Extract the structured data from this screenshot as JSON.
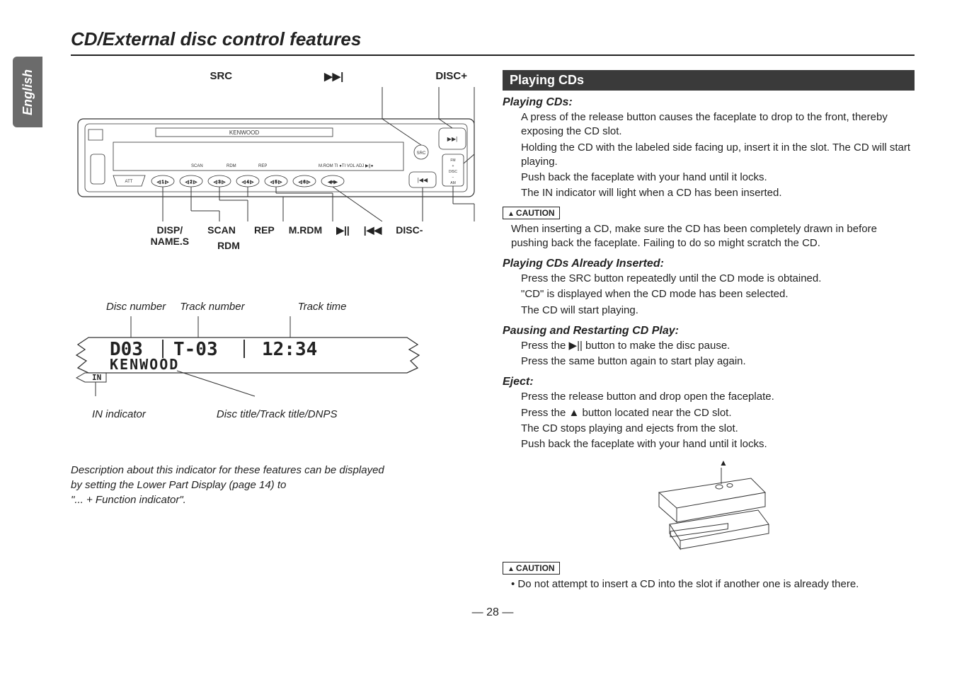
{
  "lang_tab": "English",
  "title": "CD/External disc control features",
  "device_top": {
    "src": "SRC",
    "next": "▶▶|",
    "disc_plus": "DISC+"
  },
  "device_brand": "KENWOOD",
  "device_display_small": {
    "scan": "SCAN",
    "rdm": "RDM",
    "rep": "REP",
    "mrom_ti": "M.ROM  TI ●TI VOL ADJ ▶||●"
  },
  "device_bottom": {
    "disp": "DISP/",
    "names": "NAME.S",
    "scan": "SCAN",
    "rdm": "RDM",
    "rep": "REP",
    "mrdm": "M.RDM",
    "play": "▶||",
    "prev": "|◀◀",
    "disc_minus": "DISC-"
  },
  "display_top": {
    "disc_number": "Disc number",
    "track_number": "Track number",
    "track_time": "Track time"
  },
  "display_values": {
    "disc": "D03",
    "track": "T-03",
    "time": "12:34",
    "brand": "KENWOOD",
    "in": "IN"
  },
  "display_bottom": {
    "in_indicator": "IN indicator",
    "title_line": "Disc title/Track title/DNPS"
  },
  "left_desc": {
    "l1": "Description about this indicator for these features can be displayed",
    "l2": "by setting the Lower Part Display (page 14) to",
    "l3": "\"... + Function indicator\"."
  },
  "right": {
    "header": "Playing CDs",
    "s1_head": "Playing CDs:",
    "s1_p1": "A press of the release button causes the faceplate to drop to the front, thereby exposing the CD slot.",
    "s1_p2": "Holding the CD with the labeled side facing up, insert it in the slot. The CD will start playing.",
    "s1_p3": "Push back the faceplate with your hand until it locks.",
    "s1_p4": "The IN indicator will light when a CD has been inserted.",
    "caution_label": "CAUTION",
    "caution1": "When inserting a CD, make sure the CD has been completely drawn in before pushing back the faceplate. Failing to do so might scratch the CD.",
    "s2_head": "Playing CDs Already Inserted:",
    "s2_p1": "Press the SRC button repeatedly until the CD mode is obtained.",
    "s2_p2": "\"CD\" is displayed when the CD mode has been selected.",
    "s2_p3": "The CD will start playing.",
    "s3_head": "Pausing and Restarting CD Play:",
    "s3_p1a": "Press the ",
    "s3_p1_icon": "▶||",
    "s3_p1b": " button to make the disc pause.",
    "s3_p2": "Press the same button again to start play again.",
    "s4_head": "Eject:",
    "s4_p1": "Press the release button and drop open the faceplate.",
    "s4_p2a": "Press the ",
    "s4_p2_icon": "▲",
    "s4_p2b": " button located near the CD slot.",
    "s4_p3": "The CD stops playing and ejects from the slot.",
    "s4_p4": "Push back the faceplate with your hand until it locks.",
    "caution2": "Do not attempt to insert a CD into the slot if another one is already there."
  },
  "pagenum": "— 28 —"
}
